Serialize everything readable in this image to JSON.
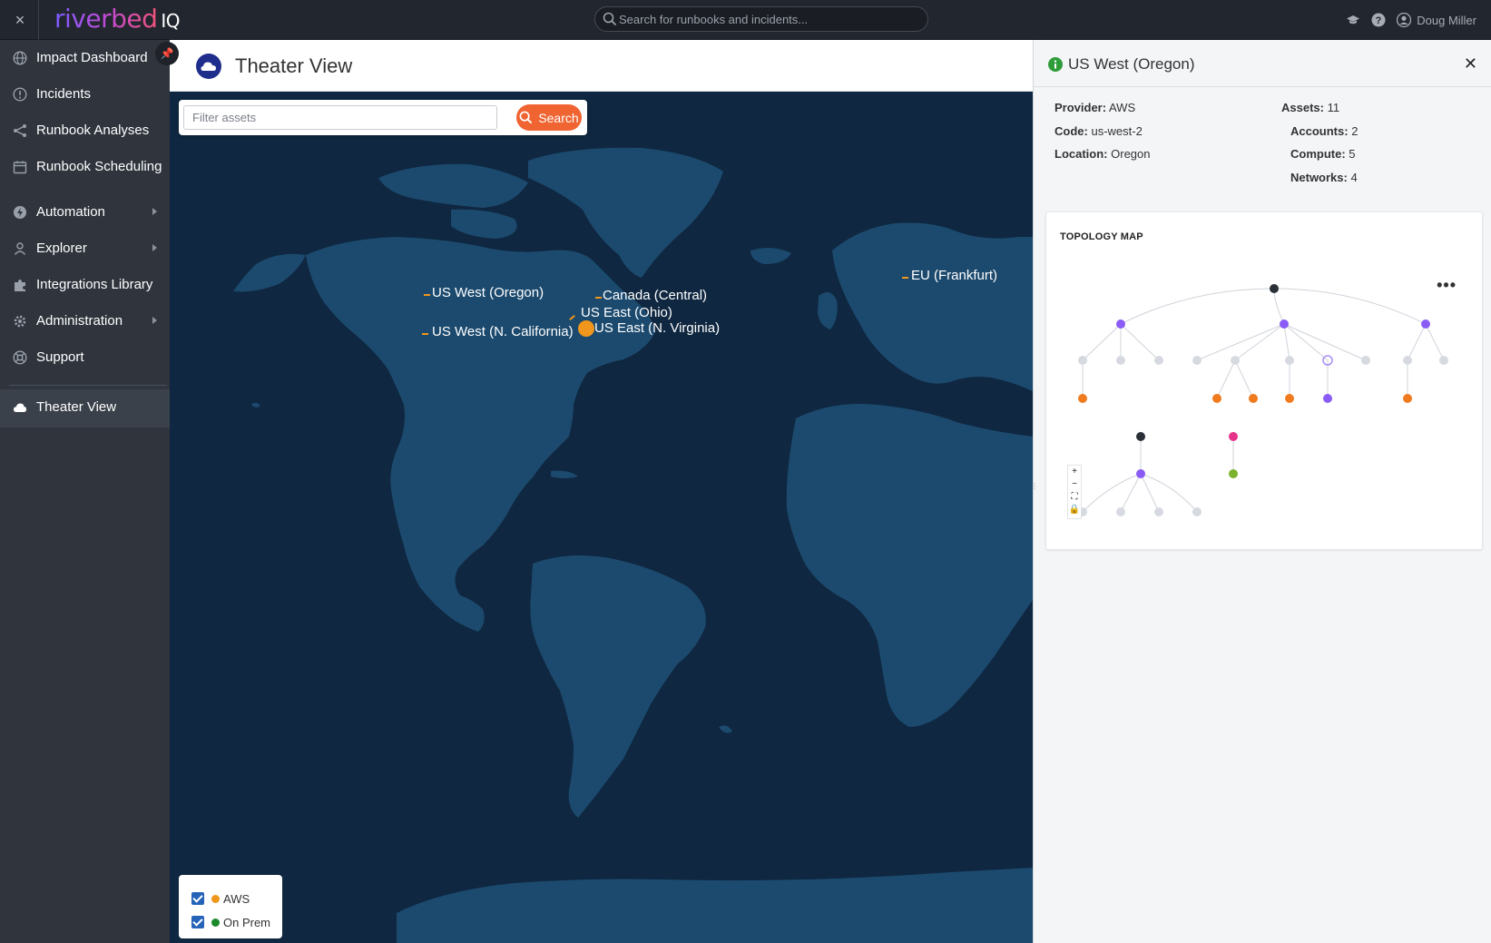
{
  "topbar": {
    "close_label": "×",
    "logo_text": "riverbed",
    "logo_suffix": "IQ",
    "search_placeholder": "Search for runbooks and incidents...",
    "user_name": "Doug Miller"
  },
  "sidebar": {
    "items": [
      {
        "label": "Impact Dashboard",
        "icon": "globe-icon"
      },
      {
        "label": "Incidents",
        "icon": "alert-circle-icon"
      },
      {
        "label": "Runbook Analyses",
        "icon": "branch-icon"
      },
      {
        "label": "Runbook Scheduling",
        "icon": "calendar-icon"
      },
      {
        "label": "Automation",
        "icon": "bolt-icon"
      },
      {
        "label": "Explorer",
        "icon": "person-icon"
      },
      {
        "label": "Integrations Library",
        "icon": "puzzle-icon"
      },
      {
        "label": "Administration",
        "icon": "gear-icon"
      },
      {
        "label": "Support",
        "icon": "lifebuoy-icon"
      },
      {
        "label": "Theater View",
        "icon": "cloud-icon"
      }
    ]
  },
  "page": {
    "title": "Theater View",
    "filter_placeholder": "Filter assets",
    "search_button": "Search"
  },
  "map": {
    "regions": [
      {
        "label": "US West (Oregon)"
      },
      {
        "label": "Canada (Central)"
      },
      {
        "label": "US East (Ohio)"
      },
      {
        "label": "US East (N. Virginia)"
      },
      {
        "label": "US West (N. California)"
      },
      {
        "label": "EU (Frankfurt)"
      }
    ],
    "legend": [
      {
        "label": "AWS",
        "color": "#f0961c",
        "checked": true
      },
      {
        "label": "On Prem",
        "color": "#1a8a2a",
        "checked": true
      }
    ]
  },
  "panel": {
    "title": "US West (Oregon)",
    "close_label": "✕",
    "provider_label": "Provider:",
    "provider": "AWS",
    "code_label": "Code:",
    "code": "us-west-2",
    "location_label": "Location:",
    "location": "Oregon",
    "assets_label": "Assets:",
    "assets": "11",
    "accounts_label": "Accounts:",
    "accounts": "2",
    "compute_label": "Compute:",
    "compute": "5",
    "networks_label": "Networks:",
    "networks": "4",
    "topology_title": "TOPOLOGY MAP"
  }
}
